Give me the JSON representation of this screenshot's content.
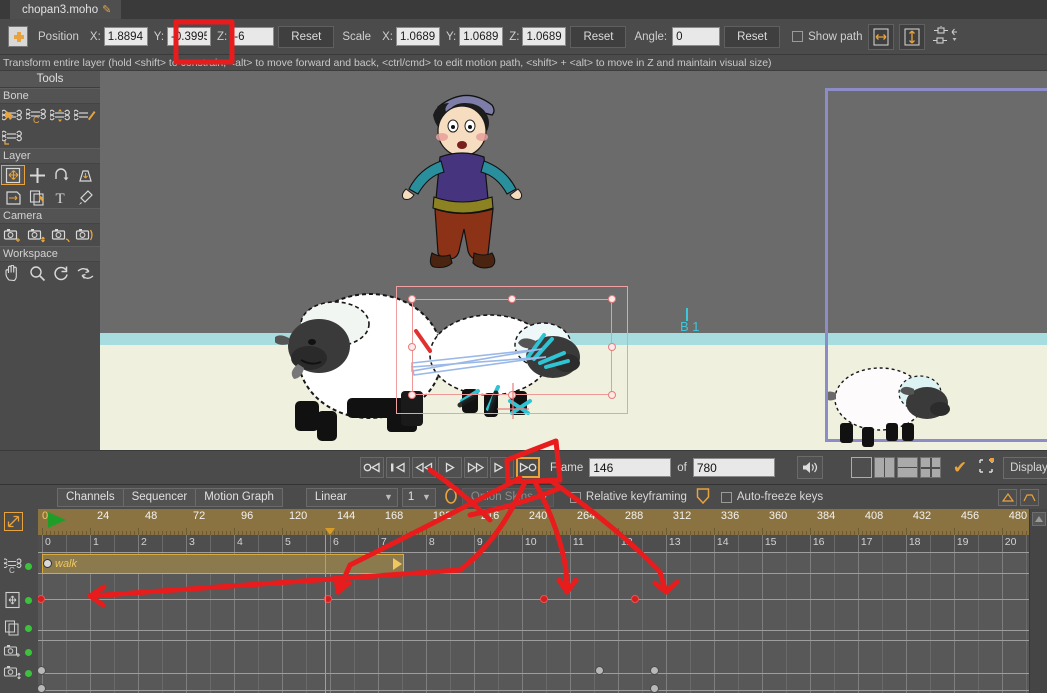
{
  "window": {
    "document_tab": "chopan3.moho",
    "modified_marker": "✎"
  },
  "toolbar": {
    "layer_icon": "layer-transform-icon",
    "position_label": "Position",
    "position": {
      "x_label": "X:",
      "x": "1.8894",
      "y_label": "Y:",
      "y": "-0.3995",
      "z_label": "Z:",
      "z": "-6"
    },
    "position_reset": "Reset",
    "scale_label": "Scale",
    "scale": {
      "x_label": "X:",
      "x": "1.0689",
      "y_label": "Y:",
      "y": "1.0689",
      "z_label": "Z:",
      "z": "1.0689"
    },
    "scale_reset": "Reset",
    "angle_label": "Angle:",
    "angle": "0",
    "angle_reset": "Reset",
    "show_path_label": "Show path",
    "show_path_checked": false,
    "icons": [
      "flip-horizontal-icon",
      "flip-vertical-icon",
      "transform-options-icon"
    ]
  },
  "hint": "Transform entire layer (hold <shift> to constrain, <alt> to move forward and back, <ctrl/cmd> to edit motion path, <shift> + <alt> to move in Z and maintain visual size)",
  "tools": {
    "title": "Tools",
    "groups": [
      {
        "label": "Bone",
        "items": [
          {
            "name": "bone-select-tool",
            "selected": false
          },
          {
            "name": "bone-rotate-tool",
            "selected": false
          },
          {
            "name": "bone-scale-tool",
            "selected": false
          },
          {
            "name": "bone-offset-tool",
            "selected": false
          },
          {
            "name": "bone-translate-tool",
            "selected": false
          }
        ]
      },
      {
        "label": "Layer",
        "items": [
          {
            "name": "transform-layer-tool",
            "selected": true
          },
          {
            "name": "move-layer-tool",
            "selected": false
          },
          {
            "name": "rotate-layer-tool",
            "selected": false
          },
          {
            "name": "shear-layer-tool",
            "selected": false
          },
          {
            "name": "flip-layer-tool",
            "selected": false
          },
          {
            "name": "layer-copy-tool",
            "selected": false
          },
          {
            "name": "text-tool",
            "selected": false
          },
          {
            "name": "eyedropper-tool",
            "selected": false
          }
        ]
      },
      {
        "label": "Camera",
        "items": [
          {
            "name": "camera-track-tool",
            "selected": false
          },
          {
            "name": "camera-zoom-tool",
            "selected": false
          },
          {
            "name": "camera-roll-tool",
            "selected": false
          },
          {
            "name": "camera-pan-tool",
            "selected": false
          }
        ]
      },
      {
        "label": "Workspace",
        "items": [
          {
            "name": "pan-tool",
            "selected": false
          },
          {
            "name": "zoom-tool",
            "selected": false
          },
          {
            "name": "rotate-workspace-tool",
            "selected": false
          },
          {
            "name": "reset-workspace-tool",
            "selected": false
          }
        ]
      }
    ]
  },
  "viewport": {
    "bone_label": "B 1",
    "colors": {
      "sky": "#6b6b6b",
      "snow_ground": "#eff0dd",
      "snow_band": "#a8dde0",
      "camera_frame": "#8c8cc8",
      "selection": "#f0a0a0",
      "bone_cyan": "#3cc8d8"
    },
    "characters": [
      "shepherd-boy",
      "sheep-large-left",
      "sheep-selected-center",
      "sheep-right-in-camera"
    ]
  },
  "playback": {
    "buttons": [
      {
        "name": "rewind-to-start-button",
        "glyph": "o◁",
        "highlighted": false
      },
      {
        "name": "previous-keyframe-button",
        "glyph": "|◁",
        "highlighted": false
      },
      {
        "name": "step-back-button",
        "glyph": "◁◁",
        "highlighted": false
      },
      {
        "name": "play-button",
        "glyph": "▷",
        "highlighted": false
      },
      {
        "name": "step-forward-button",
        "glyph": "▷▷",
        "highlighted": false
      },
      {
        "name": "next-keyframe-button",
        "glyph": "▷|",
        "highlighted": false
      },
      {
        "name": "play-to-end-button",
        "glyph": "▷o",
        "highlighted": true
      }
    ],
    "frame_label": "Frame",
    "frame_value": "146",
    "of_label": "of",
    "total_frames": "780",
    "audio_icon": "speaker-icon",
    "view_layouts": [
      "single-view-icon",
      "two-pane-icon",
      "three-pane-icon",
      "four-pane-icon"
    ],
    "checkmark": "✔",
    "crop_icon": "crop-icon",
    "display_quality_label": "Display Quality"
  },
  "channels_bar": {
    "tabs": [
      "Channels",
      "Sequencer",
      "Motion Graph"
    ],
    "interpolation": "Linear",
    "interp_count": "1",
    "onion_icon": "onion-skin-icon",
    "onion_skins_label": "Onion Skins",
    "relative_keyframing_label": "Relative keyframing",
    "relative_keyframing_checked": false,
    "shield_icon": "shield-icon",
    "auto_freeze_label": "Auto-freeze keys",
    "auto_freeze_checked": false,
    "right_icons": [
      "collapse-up-icon",
      "expand-icon"
    ]
  },
  "timeline": {
    "expand_icon": "expand-timeline-icon",
    "ruler_ticks": [
      "0",
      "24",
      "48",
      "72",
      "96",
      "120",
      "144",
      "168",
      "192",
      "216",
      "240",
      "264",
      "288",
      "312",
      "336",
      "360",
      "384",
      "408",
      "432",
      "456",
      "480"
    ],
    "sub_ticks": [
      "0",
      "1",
      "2",
      "3",
      "4",
      "5",
      "6",
      "7",
      "8",
      "9",
      "10",
      "11",
      "12",
      "13",
      "14",
      "15",
      "16",
      "17",
      "18",
      "19",
      "20"
    ],
    "playhead_frame": "146",
    "action_track": {
      "name": "walk",
      "start": "0",
      "end": "7"
    },
    "channels": [
      {
        "name": "bone-channel",
        "icon": "bone-rotate-icon",
        "enabled": true
      },
      {
        "name": "layer-transform-channel",
        "icon": "layer-transform-icon",
        "enabled": true
      },
      {
        "name": "layer-copy-channel",
        "icon": "layer-copy-icon",
        "enabled": true
      },
      {
        "name": "camera-track-channel",
        "icon": "camera-track-icon",
        "enabled": true
      },
      {
        "name": "camera-zoom-channel",
        "icon": "camera-zoom-icon",
        "enabled": true
      }
    ],
    "keyframes_red": [
      "0",
      "146",
      "256",
      "302"
    ],
    "keyframes_gray_row1": [
      "0",
      "284",
      "312"
    ],
    "keyframes_gray_row2": [
      "0",
      "312"
    ],
    "scroll_up_icon": "scroll-up-icon"
  },
  "annotations": {
    "color": "#e81c1c",
    "marks": [
      "rect-around-position-y-field",
      "rect-around-play-to-end-button",
      "arrow-to-keyframe-0",
      "arrow-to-keyframe-146",
      "arrow-to-keyframe-256",
      "arrow-to-keyframe-302"
    ]
  }
}
